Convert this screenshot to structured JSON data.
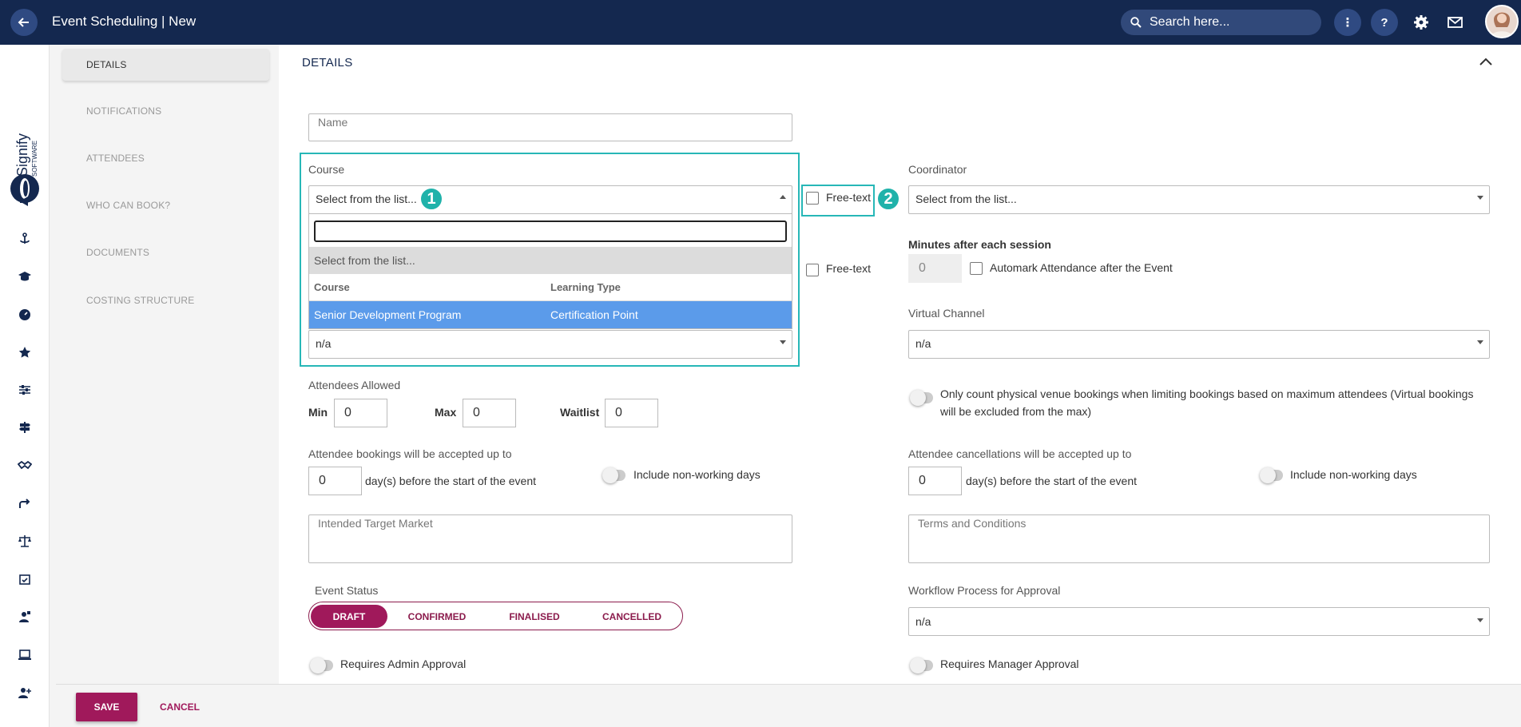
{
  "header": {
    "title": "Event Scheduling | New",
    "search_placeholder": "Search here...",
    "help_label": "?",
    "more_label": "⋮"
  },
  "section_nav": {
    "items": [
      {
        "label": "DETAILS",
        "active": true
      },
      {
        "label": "NOTIFICATIONS",
        "active": false
      },
      {
        "label": "ATTENDEES",
        "active": false
      },
      {
        "label": "WHO CAN BOOK?",
        "active": false
      },
      {
        "label": "DOCUMENTS",
        "active": false
      },
      {
        "label": "COSTING STRUCTURE",
        "active": false
      }
    ]
  },
  "logo": {
    "brand": "Signify",
    "sub": "SOFTWARE"
  },
  "panel": {
    "title": "DETAILS",
    "name_placeholder": "Name",
    "course_label": "Course",
    "course_value": "Select from the list...",
    "free_text_label": "Free-text",
    "coordinator_label": "Coordinator",
    "coordinator_value": "Select from the list...",
    "minutes_label": "Minutes after each session",
    "minutes_value": "0",
    "automark_label": "Automark Attendance after the Event",
    "virtual_channel_label": "Virtual Channel",
    "virtual_channel_value": "n/a",
    "hidden_select_value": "n/a",
    "attendees_allowed_label": "Attendees Allowed",
    "min_label": "Min",
    "min_value": "0",
    "max_label": "Max",
    "max_value": "0",
    "waitlist_label": "Waitlist",
    "waitlist_value": "0",
    "physical_only_label": "Only count physical venue bookings when limiting bookings based on maximum attendees (Virtual bookings will be excluded from the max)",
    "bookings_label": "Attendee bookings will be accepted up to",
    "bookings_value": "0",
    "days_before_label": "day(s) before the start of the event",
    "include_nonworking_label": "Include non-working days",
    "cancellations_label": "Attendee cancellations will be accepted up to",
    "cancellations_value": "0",
    "target_market_placeholder": "Intended Target Market",
    "terms_placeholder": "Terms and Conditions",
    "event_status_label": "Event Status",
    "statuses": [
      "DRAFT",
      "CONFIRMED",
      "FINALISED",
      "CANCELLED"
    ],
    "active_status": "DRAFT",
    "workflow_label": "Workflow Process for Approval",
    "workflow_value": "n/a",
    "admin_approval_label": "Requires Admin Approval",
    "manager_approval_label": "Requires Manager Approval"
  },
  "course_dropdown": {
    "search_value": "",
    "first_option": "Select from the list...",
    "columns": [
      "Course",
      "Learning Type"
    ],
    "rows": [
      {
        "course": "Senior Development Program",
        "type": "Certification Point"
      }
    ]
  },
  "callouts": [
    "1",
    "2"
  ],
  "footer": {
    "save_label": "SAVE",
    "cancel_label": "CANCEL"
  },
  "colors": {
    "navy": "#14284f",
    "accent": "#a0195b",
    "highlight": "#27b7b7",
    "selected_row": "#5b9bea"
  }
}
